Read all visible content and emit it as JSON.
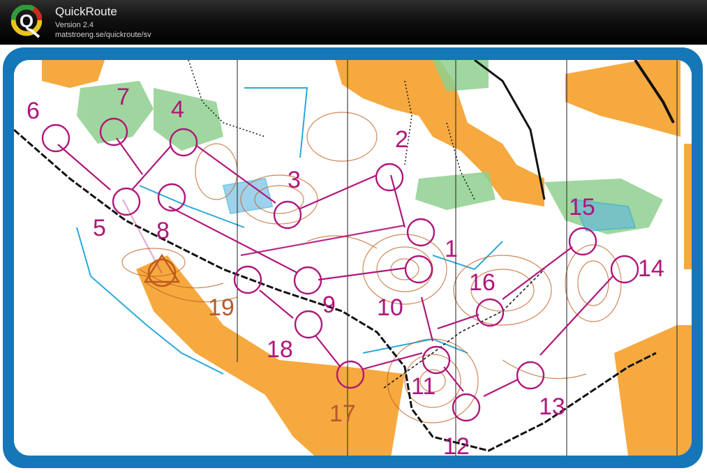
{
  "window": {
    "title": "QuickRoute",
    "version": "Version 2.4",
    "url": "matstroeng.se/quickroute/sv",
    "logo_letter": "Q"
  },
  "colors": {
    "frame": "#1577b8",
    "course": "#b0167a",
    "open_land": "#f6a93f",
    "vegetation": "#8fd08f",
    "water": "#2aa8d8",
    "contour": "#c06020"
  },
  "course": {
    "start_marker": "start-triangle",
    "controls": [
      {
        "number": "1"
      },
      {
        "number": "2"
      },
      {
        "number": "3"
      },
      {
        "number": "4"
      },
      {
        "number": "5"
      },
      {
        "number": "6"
      },
      {
        "number": "7"
      },
      {
        "number": "8"
      },
      {
        "number": "9"
      },
      {
        "number": "10"
      },
      {
        "number": "11"
      },
      {
        "number": "12"
      },
      {
        "number": "13"
      },
      {
        "number": "14"
      },
      {
        "number": "15"
      },
      {
        "number": "16"
      },
      {
        "number": "17"
      },
      {
        "number": "18"
      },
      {
        "number": "19"
      }
    ]
  }
}
